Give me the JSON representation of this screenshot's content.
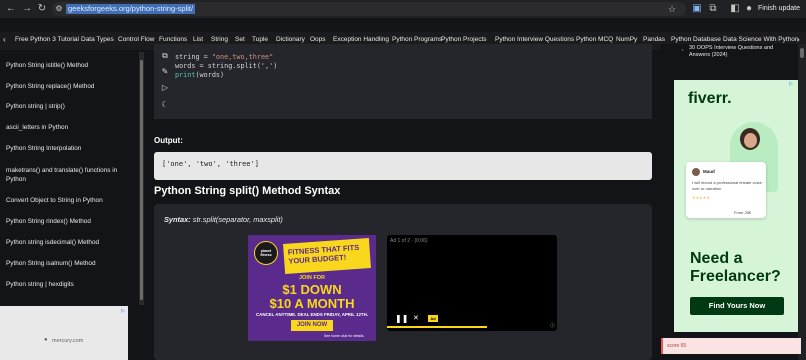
{
  "browser": {
    "url": "geeksforgeeks.org/python-string-split/",
    "finish_update_label": "Finish update"
  },
  "category_nav": {
    "items": [
      "Free Python 3 Tutorial",
      "Data Types",
      "Control Flow",
      "Functions",
      "List",
      "String",
      "Set",
      "Tuple",
      "Dictionary",
      "Oops",
      "Exception Handling",
      "Python Programs",
      "Python Projects",
      "Python Interview Questions",
      "Python MCQ",
      "NumPy",
      "Pandas",
      "Python Database",
      "Data Science With Python"
    ]
  },
  "sidebar": {
    "links": [
      "Python String istitle() Method",
      "Python String replace() Method",
      "Python string | strip()",
      "ascii_letters in Python",
      "Python String Interpolation",
      "maketrans() and translate() functions in Python",
      "Convert Object to String in Python",
      "Python String rindex() Method",
      "Python string isdecimal() Method",
      "Python String isalnum() Method",
      "Python string | hexdigits"
    ],
    "ad_domain": "mercury.com"
  },
  "code": {
    "line1_var": "string",
    "line1_op": " = ",
    "line1_val": "\"one,two,three\"",
    "line2": "words = string.split(',')",
    "line3_fn": "print",
    "line3_rest": "(words)"
  },
  "output": {
    "label": "Output:",
    "text": "['one', 'two', 'three']"
  },
  "syntax": {
    "heading": "Python String split() Method Syntax",
    "label": "Syntax:",
    "value": " str.split(separator, maxsplit)"
  },
  "pf_ad": {
    "brand": "planet fitness",
    "banner": "FITNESS THAT FITS YOUR BUDGET!",
    "join_for": "JOIN FOR",
    "price_down": "$1 DOWN",
    "price_month": "$10 A MONTH",
    "cancel": "CANCEL ANYTIME. DEAL ENDS FRIDAY, APRIL 12TH.",
    "join_button": "JOIN NOW",
    "footer": "See home club for details."
  },
  "video": {
    "ad_counter": "Ad 1 of 2 · (0:06)",
    "ad_badge": "Ad"
  },
  "right_panel": {
    "link_text": "30 OOPS Interview Questions and Answers (2024)",
    "fiverr_logo": "fiverr.",
    "headline_line1": "Need a",
    "headline_line2": "Freelancer?",
    "cta": "Find Yours Now",
    "card_name": "Maud",
    "card_text": "I will record a professional female voice over or narration",
    "card_price": "From 25€",
    "score": "score 65"
  },
  "colors": {
    "accent_green": "#1dbf73",
    "fiverr_dark": "#013914",
    "pf_purple": "#5a2a8c",
    "pf_yellow": "#f9d71c"
  }
}
